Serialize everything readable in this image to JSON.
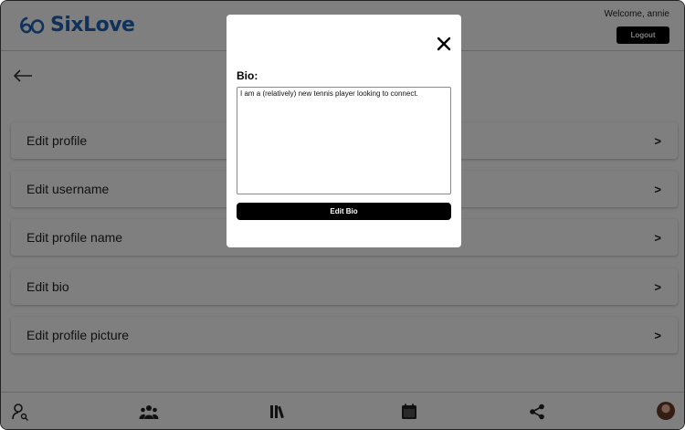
{
  "header": {
    "logo_text": "SixLove",
    "welcome": "Welcome, annie",
    "logout_label": "Logout"
  },
  "settings": {
    "items": [
      {
        "label": "Edit profile",
        "chevron": ">"
      },
      {
        "label": "Edit username",
        "chevron": ">"
      },
      {
        "label": "Edit profile name",
        "chevron": ">"
      },
      {
        "label": "Edit bio",
        "chevron": ">"
      },
      {
        "label": "Edit profile picture",
        "chevron": ">"
      }
    ]
  },
  "modal": {
    "close_icon": "close-icon",
    "bio_label": "Bio:",
    "bio_value": "I am a (relatively) new tennis player looking to connect.",
    "edit_button_label": "Edit Bio"
  },
  "bottom_nav": {
    "icons": [
      "person-search-icon",
      "group-icon",
      "library-icon",
      "calendar-icon",
      "share-icon",
      "avatar"
    ]
  },
  "colors": {
    "brand": "#1e63b8",
    "overlay": "rgba(0,0,0,0.5)",
    "button_bg": "#000000"
  }
}
